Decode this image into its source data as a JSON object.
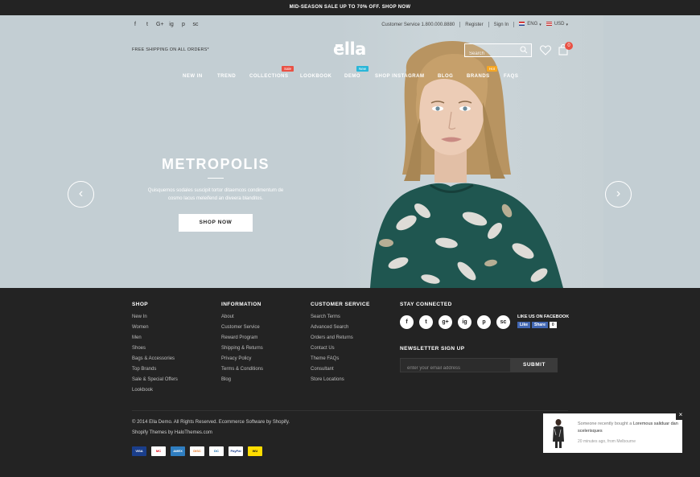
{
  "promo": {
    "text": "MID-SEASON SALE UP TO 70% OFF. SHOP NOW"
  },
  "header": {
    "social": [
      "f",
      "t",
      "G+",
      "ig",
      "p",
      "sc"
    ],
    "customer_service": "Customer Service 1.800.000.8880",
    "register": "Register",
    "sign_in": "Sign In",
    "language": "ENG",
    "currency": "USD",
    "free_shipping": "FREE SHIPPING ON ALL ORDERS*",
    "logo": "ella",
    "search_placeholder": "Search",
    "cart_count": "0"
  },
  "nav": {
    "items": [
      "NEW IN",
      "TREND",
      "COLLECTIONS",
      "LOOKBOOK",
      "DEMO",
      "SHOP INSTAGRAM",
      "BLOG",
      "BRANDS",
      "FAQS"
    ],
    "tags": {
      "collections": "Sale",
      "demo": "New",
      "brands": "Hot"
    }
  },
  "slide": {
    "title": "METROPOLIS",
    "text1": "Quisquemos sodales suscipit tortor ditaemcos condimentum de",
    "text2": "cosmo lacus meleifend an diveera blanditos.",
    "button": "SHOP NOW"
  },
  "footer": {
    "shop": {
      "heading": "SHOP",
      "items": [
        "New In",
        "Women",
        "Men",
        "Shoes",
        "Bags & Accessories",
        "Top Brands",
        "Sale & Special Offers",
        "Lookbook"
      ]
    },
    "information": {
      "heading": "INFORMATION",
      "items": [
        "About",
        "Customer Service",
        "Reward Program",
        "Shipping & Returns",
        "Privacy Policy",
        "Terms & Conditions",
        "Blog"
      ]
    },
    "customer_service": {
      "heading": "CUSTOMER SERVICE",
      "items": [
        "Search Terms",
        "Advanced Search",
        "Orders and Returns",
        "Contact Us",
        "Theme FAQs",
        "Consultant",
        "Store Locations"
      ]
    },
    "stay_connected": "STAY CONNECTED",
    "social": [
      "f",
      "t",
      "g+",
      "ig",
      "p",
      "sc"
    ],
    "fb_label": "LIKE US ON FACEBOOK",
    "fb_like": "Like",
    "fb_share": "Share",
    "fb_count": "0",
    "newsletter_heading": "NEWSLETTER SIGN UP",
    "newsletter_placeholder": "enter your email address",
    "newsletter_button": "SUBMIT",
    "copyright": "© 2014 Ella Demo. All Rights Reserved. Ecommerce Software by Shopify.",
    "credits": "Shopify Themes by HaloThemes.com",
    "payments": [
      "VISA",
      "MC",
      "AMEX",
      "DISC",
      "DC",
      "PayPal",
      "WU"
    ]
  },
  "popup": {
    "prefix": "Someone recently bought a",
    "product": "Loremous saliduar dan scelerisques",
    "meta": "20 minutes ago, from Melbourne",
    "close": "×"
  },
  "colors": {
    "hero_bg": "#c3ced3",
    "dark": "#232323",
    "sale": "#e95144",
    "new": "#29b6d8",
    "hot": "#f5a623"
  }
}
